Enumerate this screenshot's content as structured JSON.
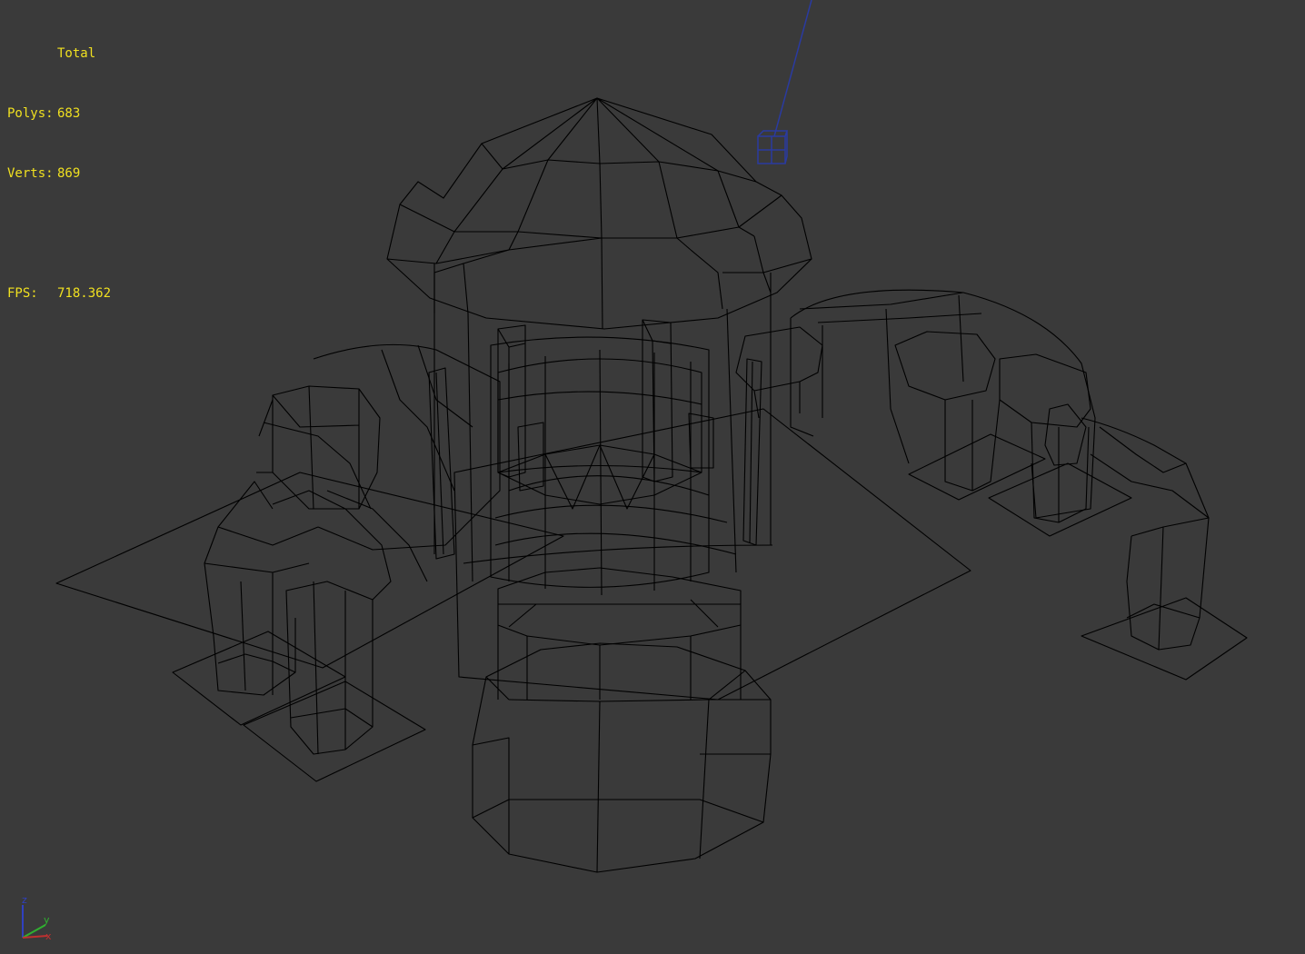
{
  "viewport": {
    "view_mode": "wireframe",
    "background_color": "#3a3a3a",
    "wire_color": "#000000",
    "selected_color": "#2a3aa0"
  },
  "stats": {
    "total_label": "Total",
    "polys_label": "Polys:",
    "polys_value": "683",
    "verts_label": "Verts:",
    "verts_value": "869",
    "fps_label": "FPS:",
    "fps_value": "718.362"
  },
  "axis_gizmo": {
    "z_label": "z",
    "y_label": "y",
    "x_label": "x",
    "colors": {
      "x": "#c03030",
      "y": "#30b030",
      "z": "#3040c0"
    }
  },
  "objects": {
    "main_model": "wireframe-tower-structure",
    "light_object": "light-target-icon"
  }
}
